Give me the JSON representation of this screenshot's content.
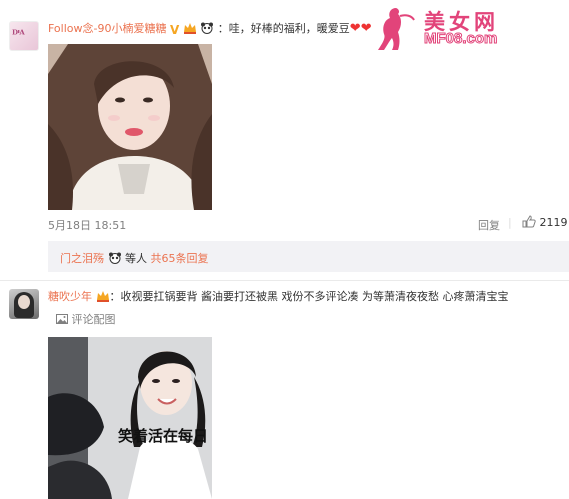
{
  "watermark": {
    "logo_cn": "美女网",
    "logo_en": "MF08.com"
  },
  "comments": [
    {
      "username": "Follow念-90小楠爱糖糖",
      "separator": "：",
      "text": "哇，好棒的福利，暖爱豆",
      "badges": [
        "v-badge",
        "member-crown-icon",
        "panda-icon"
      ],
      "emojis": [
        "heart-icon",
        "heart-icon"
      ],
      "date": "5月18日",
      "time": "18:51",
      "reply_label": "回复",
      "like_count": "2119",
      "replies": {
        "names": "门之泪殇",
        "suffix": "等人",
        "count_text": "共65条回复"
      }
    },
    {
      "username": "糖吹少年",
      "separator": "：",
      "text": "收视要扛锅要背 酱油要打还被黑  戏份不多评论凑 为等萧清夜夜愁 心疼萧清宝宝",
      "badges": [
        "member-crown-icon"
      ],
      "comment_image_label": "评论配图",
      "photo_caption": "笑着活在每日"
    }
  ],
  "colors": {
    "username": "#eb7350",
    "meta": "#808080",
    "reply_bg": "#f2f2f5",
    "watermark": "#e2447a"
  }
}
